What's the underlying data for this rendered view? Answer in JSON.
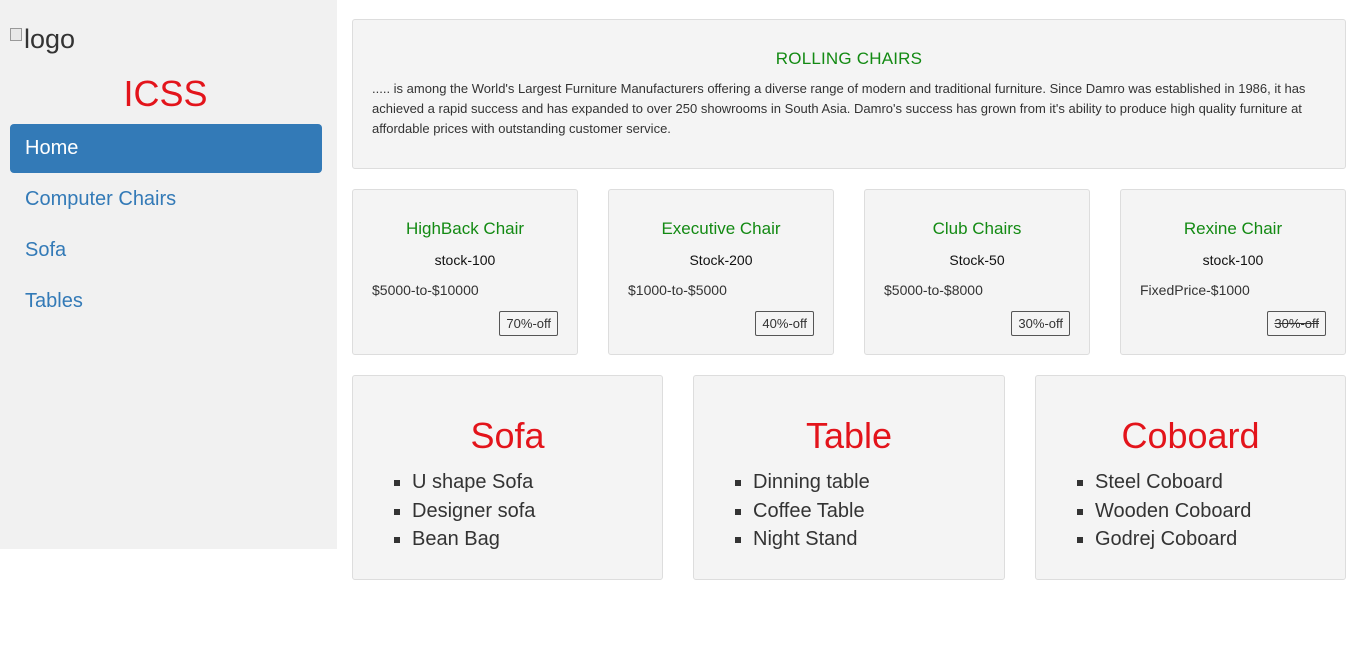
{
  "sidebar": {
    "logo_alt": "logo",
    "brand": "ICSS",
    "items": [
      {
        "label": "Home",
        "active": true
      },
      {
        "label": "Computer Chairs",
        "active": false
      },
      {
        "label": "Sofa",
        "active": false
      },
      {
        "label": "Tables",
        "active": false
      }
    ]
  },
  "hero": {
    "title": "ROLLING CHAIRS",
    "text": "..... is among the World's Largest Furniture Manufacturers offering a diverse range of modern and traditional furniture. Since Damro was established in 1986, it has achieved a rapid success and has expanded to over 250 showrooms in South Asia. Damro's success has grown from it's ability to produce high quality furniture at affordable prices with outstanding customer service."
  },
  "products": [
    {
      "title": "HighBack Chair",
      "stock": "stock-100",
      "price": "$5000-to-$10000",
      "badge": "70%-off",
      "strike": false
    },
    {
      "title": "Executive Chair",
      "stock": "Stock-200",
      "price": "$1000-to-$5000",
      "badge": "40%-off",
      "strike": false
    },
    {
      "title": "Club Chairs",
      "stock": "Stock-50",
      "price": "$5000-to-$8000",
      "badge": "30%-off",
      "strike": false
    },
    {
      "title": "Rexine Chair",
      "stock": "stock-100",
      "price": "FixedPrice-$1000",
      "badge": "30%-off",
      "strike": true
    }
  ],
  "categories": [
    {
      "title": "Sofa",
      "items": [
        "U shape Sofa",
        "Designer sofa",
        "Bean Bag"
      ]
    },
    {
      "title": "Table",
      "items": [
        "Dinning table",
        "Coffee Table",
        "Night Stand"
      ]
    },
    {
      "title": "Coboard",
      "items": [
        "Steel Coboard",
        "Wooden Coboard",
        "Godrej Coboard"
      ]
    }
  ],
  "colors": {
    "brand_red": "#e3141b",
    "link_blue": "#337ab7",
    "title_green": "#138a13"
  }
}
